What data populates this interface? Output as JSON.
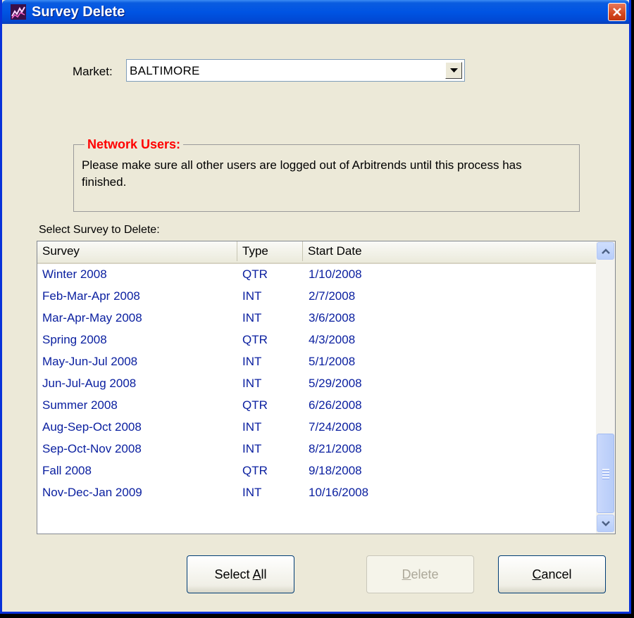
{
  "window": {
    "title": "Survey Delete"
  },
  "market": {
    "label": "Market:",
    "value": "BALTIMORE"
  },
  "notice": {
    "title": "Network Users:",
    "text": "Please make sure all other users are logged out of Arbitrends until this process has finished."
  },
  "list": {
    "label": "Select Survey to Delete:",
    "columns": [
      "Survey",
      "Type",
      "Start Date"
    ],
    "rows": [
      {
        "survey": "Winter 2008",
        "type": "QTR",
        "start": "1/10/2008"
      },
      {
        "survey": "Feb-Mar-Apr 2008",
        "type": "INT",
        "start": "2/7/2008"
      },
      {
        "survey": "Mar-Apr-May 2008",
        "type": "INT",
        "start": "3/6/2008"
      },
      {
        "survey": "Spring 2008",
        "type": "QTR",
        "start": "4/3/2008"
      },
      {
        "survey": "May-Jun-Jul 2008",
        "type": "INT",
        "start": "5/1/2008"
      },
      {
        "survey": "Jun-Jul-Aug 2008",
        "type": "INT",
        "start": "5/29/2008"
      },
      {
        "survey": "Summer 2008",
        "type": "QTR",
        "start": "6/26/2008"
      },
      {
        "survey": "Aug-Sep-Oct 2008",
        "type": "INT",
        "start": "7/24/2008"
      },
      {
        "survey": "Sep-Oct-Nov 2008",
        "type": "INT",
        "start": "8/21/2008"
      },
      {
        "survey": "Fall 2008",
        "type": "QTR",
        "start": "9/18/2008"
      },
      {
        "survey": "Nov-Dec-Jan 2009",
        "type": "INT",
        "start": "10/16/2008"
      }
    ]
  },
  "buttons": {
    "select_all_pre": "Select ",
    "select_all_key": "A",
    "select_all_post": "ll",
    "delete_key": "D",
    "delete_post": "elete",
    "cancel_key": "C",
    "cancel_post": "ancel"
  },
  "colors": {
    "title_bar": "#0054e3",
    "notice_title": "#ff0000",
    "row_text": "#0b20a0"
  }
}
